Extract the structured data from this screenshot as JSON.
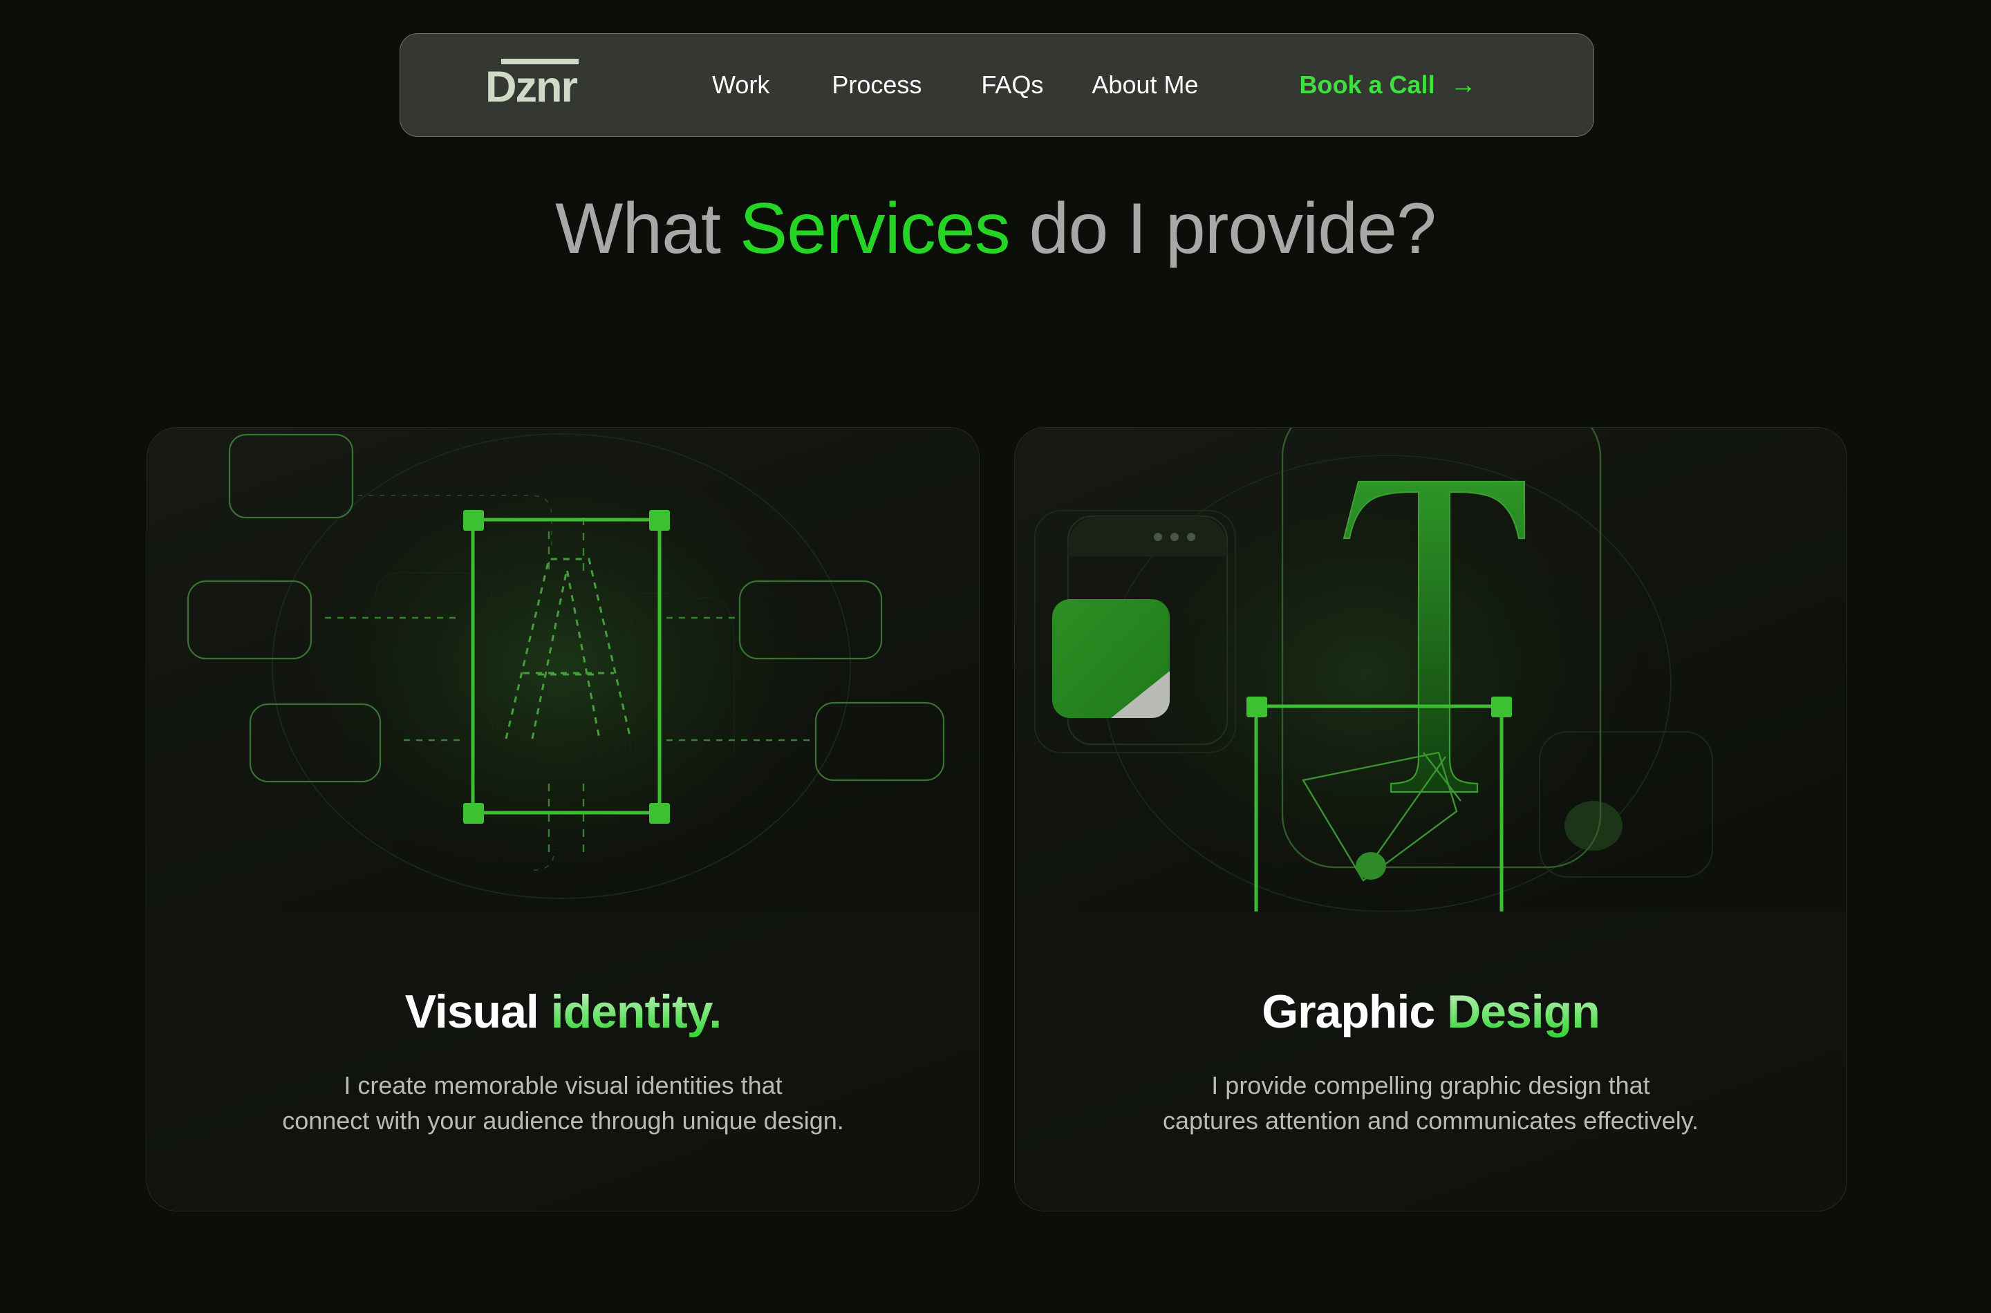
{
  "brand": {
    "logo_text": "Dznr"
  },
  "nav": {
    "links": [
      {
        "label": "Work"
      },
      {
        "label": "Process"
      },
      {
        "label": "FAQs"
      },
      {
        "label": "About Me"
      }
    ],
    "cta": {
      "label": "Book a Call",
      "arrow": "→"
    }
  },
  "heading": {
    "before": "What ",
    "accent": "Services",
    "after": " do I provide?"
  },
  "cards": [
    {
      "title_plain": "Visual ",
      "title_accent": "identity.",
      "description": "I create memorable visual identities that\nconnect with your audience through unique design.",
      "illustration": "letter-a-selection-artboard"
    },
    {
      "title_plain": "Graphic ",
      "title_accent": "Design",
      "description": "I provide compelling graphic design that\ncaptures attention and communicates effectively.",
      "illustration": "serif-t-swatch-pen-tool"
    }
  ],
  "colors": {
    "page_background": "#0c0e0a",
    "navbar_background": "#353733",
    "accent_green": "#25d425",
    "cta_green": "#3ee03e",
    "heading_gray": "#a8a8a8",
    "body_gray": "#b9bbb7",
    "logo_light": "#cfdac7",
    "card_border": "#272a24",
    "swatch_green": "#2a8a22"
  }
}
